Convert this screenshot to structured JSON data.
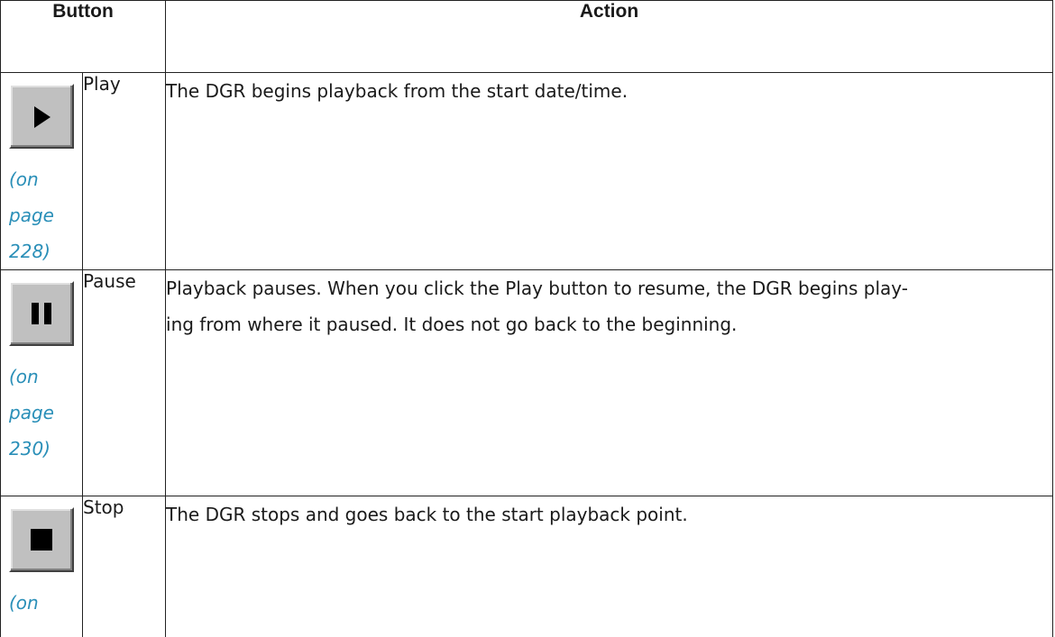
{
  "table": {
    "headers": {
      "button": "Button",
      "action": "Action"
    },
    "rows": [
      {
        "icon": "play-icon",
        "label": "Play",
        "link": "(on\npage\n228)",
        "action": "The DGR begins playback from the start date/time."
      },
      {
        "icon": "pause-icon",
        "label": "Pause",
        "link": "(on\npage\n230)",
        "action_line1": "Playback pauses. When you click the Play button to resume, the DGR begins play-",
        "action_line2": "ing from where it paused. It does not go back to the beginning."
      },
      {
        "icon": "stop-icon",
        "label": "Stop",
        "link": "(on",
        "action": "The DGR stops and goes back to the start playback point."
      }
    ]
  },
  "colors": {
    "link": "#2a8fb8",
    "button_face": "#c0c0c0",
    "text": "#1a1a1a",
    "border": "#222222"
  }
}
